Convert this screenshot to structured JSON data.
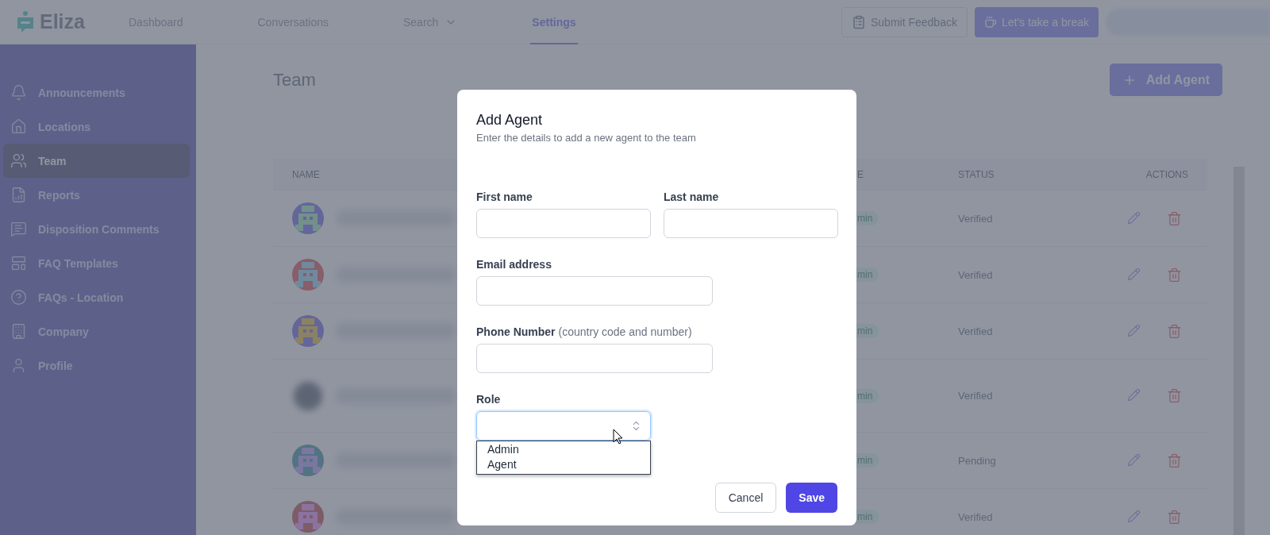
{
  "nav": {
    "logo": "Eliza",
    "items": [
      {
        "label": "Dashboard",
        "selected": false,
        "dropdown": false
      },
      {
        "label": "Conversations",
        "selected": false,
        "dropdown": false
      },
      {
        "label": "Search",
        "selected": false,
        "dropdown": true
      },
      {
        "label": "Settings",
        "selected": true,
        "dropdown": false
      }
    ],
    "feedback_button": "Submit Feedback",
    "break_button": "Let's take a break"
  },
  "sidebar": {
    "items": [
      {
        "label": "Announcements",
        "selected": false
      },
      {
        "label": "Locations",
        "selected": false
      },
      {
        "label": "Team",
        "selected": true
      },
      {
        "label": "Reports",
        "selected": false
      },
      {
        "label": "Disposition Comments",
        "selected": false
      },
      {
        "label": "FAQ Templates",
        "selected": false
      },
      {
        "label": "FAQs - Location",
        "selected": false
      },
      {
        "label": "Company",
        "selected": false
      },
      {
        "label": "Profile",
        "selected": false
      }
    ]
  },
  "page": {
    "title": "Team",
    "add_button": "Add Agent"
  },
  "table": {
    "columns": [
      "NAME",
      "E",
      "STATUS",
      "ACTIONS"
    ],
    "rows": [
      {
        "kind": "pixel",
        "role": "min",
        "status": "Verified"
      },
      {
        "kind": "pixel",
        "role": "min",
        "status": "Verified"
      },
      {
        "kind": "pixel",
        "role": "min",
        "status": "Verified"
      },
      {
        "kind": "blurred",
        "role": "min",
        "status": "Verified"
      },
      {
        "kind": "pixel",
        "role": "min",
        "status": "Pending"
      },
      {
        "kind": "pixel",
        "role": "min",
        "status": "Verified"
      }
    ]
  },
  "modal": {
    "title": "Add Agent",
    "subtitle": "Enter the details to add a new agent to the team",
    "field_rows": [
      [
        {
          "label": "First name"
        },
        {
          "label": "Last name"
        }
      ],
      [
        {
          "label": "Email address"
        }
      ],
      [
        {
          "label": "Phone Number",
          "hint": "(country code and number)"
        }
      ]
    ],
    "role": {
      "label": "Role",
      "focused": true,
      "open": true,
      "options": [
        "Admin",
        "Agent"
      ]
    },
    "cancel": "Cancel",
    "save": "Save"
  }
}
